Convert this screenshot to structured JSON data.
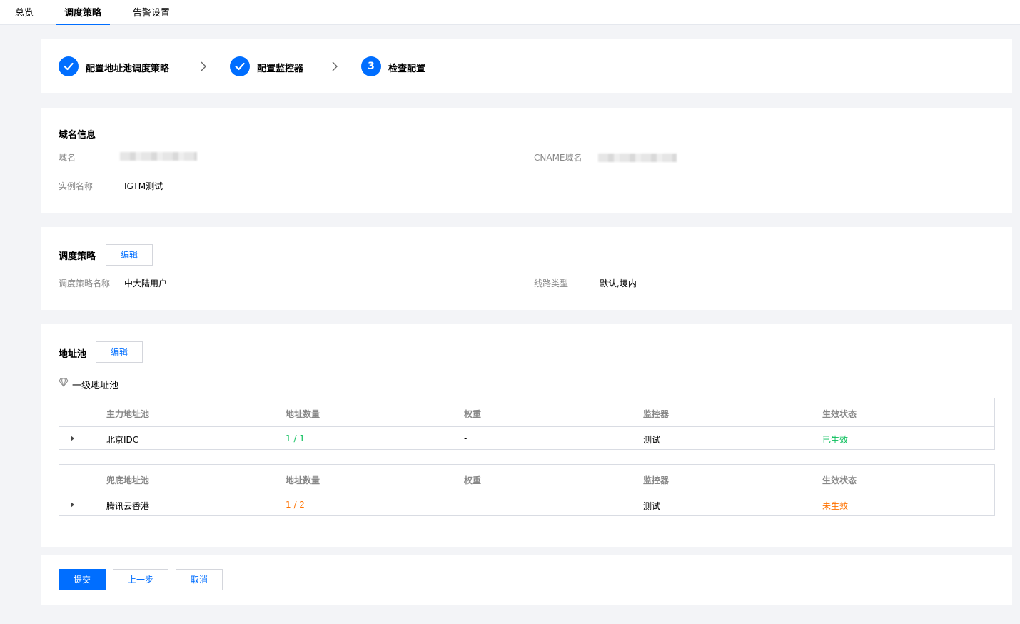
{
  "tabs": [
    {
      "label": "总览"
    },
    {
      "label": "调度策略",
      "active": true
    },
    {
      "label": "告警设置"
    }
  ],
  "steps": [
    {
      "label": "配置地址池调度策略",
      "status": "done"
    },
    {
      "label": "配置监控器",
      "status": "done"
    },
    {
      "label": "检查配置",
      "status": "current",
      "number": "3"
    }
  ],
  "domain_info": {
    "title": "域名信息",
    "domain_label": "域名",
    "cname_label": "CNAME域名",
    "instance_label": "实例名称",
    "instance_value": "IGTM测试"
  },
  "strategy": {
    "title": "调度策略",
    "edit_label": "编辑",
    "name_label": "调度策略名称",
    "name_value": "中大陆用户",
    "line_label": "线路类型",
    "line_value": "默认,境内"
  },
  "pool": {
    "title": "地址池",
    "edit_label": "编辑",
    "level_label": "一级地址池",
    "tables": [
      {
        "headers": [
          "主力地址池",
          "地址数量",
          "权重",
          "监控器",
          "生效状态"
        ],
        "rows": [
          [
            "北京IDC",
            "1 / 1",
            "-",
            "测试",
            "已生效"
          ]
        ]
      },
      {
        "headers": [
          "兜底地址池",
          "地址数量",
          "权重",
          "监控器",
          "生效状态"
        ],
        "rows": [
          [
            "腾讯云香港",
            "1 / 2",
            "-",
            "测试",
            "未生效"
          ]
        ]
      }
    ]
  },
  "colors": {
    "accent": "#006eff",
    "success": "#0abf5b",
    "warning": "#ff7200"
  },
  "actions": {
    "submit": "提交",
    "prev": "上一步",
    "cancel": "取消"
  }
}
